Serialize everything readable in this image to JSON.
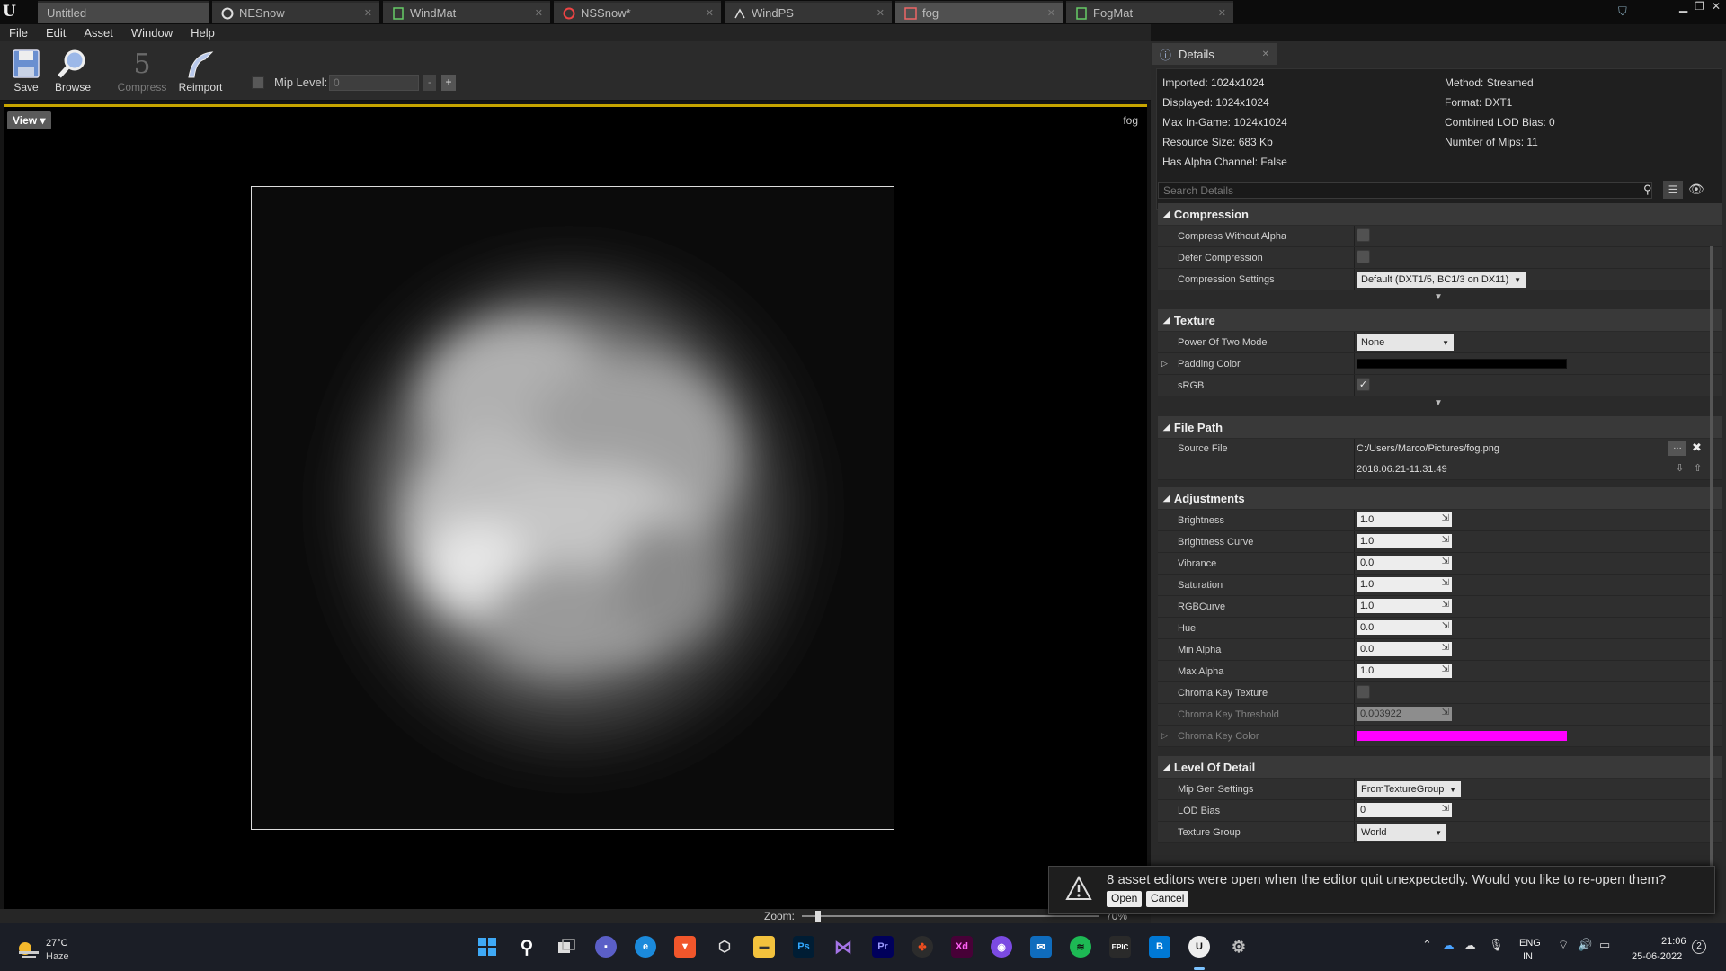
{
  "tabs": [
    {
      "label": "Untitled",
      "icon": "unreal-logo-icon"
    },
    {
      "label": "NESnow",
      "icon": "material-circle-icon"
    },
    {
      "label": "WindMat",
      "icon": "material-icon"
    },
    {
      "label": "NSSnow*",
      "icon": "material-circle-icon"
    },
    {
      "label": "WindPS",
      "icon": "particle-system-icon"
    },
    {
      "label": "fog",
      "icon": "texture-icon"
    },
    {
      "label": "FogMat",
      "icon": "material-icon"
    }
  ],
  "menu": [
    "File",
    "Edit",
    "Asset",
    "Window",
    "Help"
  ],
  "toolbar": {
    "save": "Save",
    "browse": "Browse",
    "compress": "Compress",
    "reimport": "Reimport",
    "mip_label": "Mip Level:",
    "mip_value": "0",
    "minus": "-",
    "plus": "+"
  },
  "viewport": {
    "view_button": "View",
    "asset_name": "fog",
    "zoom_label": "Zoom:",
    "zoom_value": "70%"
  },
  "details": {
    "tab": "Details",
    "stats": {
      "imported": "Imported: 1024x1024",
      "displayed": "Displayed: 1024x1024",
      "max_ingame": "Max In-Game: 1024x1024",
      "resource_size": "Resource Size: 683 Kb",
      "has_alpha": "Has Alpha Channel: False",
      "method": "Method: Streamed",
      "format": "Format: DXT1",
      "lod_bias": "Combined LOD Bias: 0",
      "num_mips": "Number of Mips: 11"
    },
    "search_placeholder": "Search Details",
    "compression": {
      "title": "Compression",
      "without_alpha": "Compress Without Alpha",
      "defer": "Defer Compression",
      "settings_label": "Compression Settings",
      "settings_value": "Default (DXT1/5, BC1/3 on DX11)"
    },
    "texture": {
      "title": "Texture",
      "pot_label": "Power Of Two Mode",
      "pot_value": "None",
      "padding_label": "Padding Color",
      "srgb_label": "sRGB"
    },
    "file_path": {
      "title": "File Path",
      "source_label": "Source File",
      "source_value": "C:/Users/Marco/Pictures/fog.png",
      "timestamp": "2018.06.21-11.31.49"
    },
    "adjustments": {
      "title": "Adjustments",
      "rows": [
        {
          "label": "Brightness",
          "value": "1.0"
        },
        {
          "label": "Brightness Curve",
          "value": "1.0"
        },
        {
          "label": "Vibrance",
          "value": "0.0"
        },
        {
          "label": "Saturation",
          "value": "1.0"
        },
        {
          "label": "RGBCurve",
          "value": "1.0"
        },
        {
          "label": "Hue",
          "value": "0.0"
        },
        {
          "label": "Min Alpha",
          "value": "0.0"
        },
        {
          "label": "Max Alpha",
          "value": "1.0"
        }
      ],
      "chroma_texture": "Chroma Key Texture",
      "chroma_threshold_label": "Chroma Key Threshold",
      "chroma_threshold_value": "0.003922",
      "chroma_color": "Chroma Key Color"
    },
    "lod": {
      "title": "Level Of Detail",
      "mipgen_label": "Mip Gen Settings",
      "mipgen_value": "FromTextureGroup",
      "lodbias_label": "LOD Bias",
      "lodbias_value": "0",
      "group_label": "Texture Group",
      "group_value": "World"
    }
  },
  "notification": {
    "message": "8 asset editors were open when the editor quit unexpectedly. Would you like to re-open them?",
    "open": "Open",
    "cancel": "Cancel"
  },
  "taskbar": {
    "temp": "27°C",
    "weather": "Haze",
    "lang1": "ENG",
    "lang2": "IN",
    "time": "21:06",
    "date": "25-06-2022",
    "notif_count": "2"
  },
  "colors": {
    "accent": "#c7a500",
    "chroma": "#ff00ff",
    "padding": "#000000"
  }
}
